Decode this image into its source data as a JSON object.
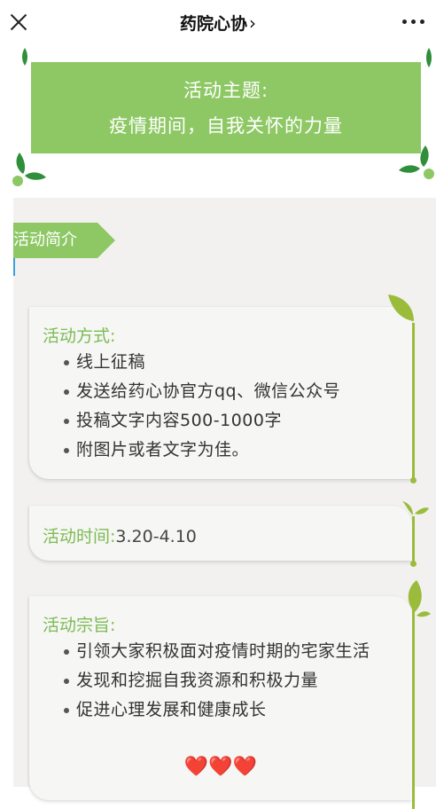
{
  "nav": {
    "title": "药院心协",
    "chevron": "›",
    "close_icon": "close-icon",
    "more_icon": "more-icon"
  },
  "banner": {
    "line1": "活动主题:",
    "line2": "疫情期间，自我关怀的力量",
    "color": "#8ec865"
  },
  "section_tag": {
    "label": "活动简介"
  },
  "card_method": {
    "heading": "活动方式:",
    "items": [
      "线上征稿",
      "发送给药心协官方qq、微信公众号",
      "投稿文字内容500-1000字",
      "附图片或者文字为佳。"
    ]
  },
  "card_time": {
    "heading": "活动时间:",
    "value": "3.20-4.10"
  },
  "card_purpose": {
    "heading": "活动宗旨:",
    "items": [
      "引领大家积极面对疫情时期的宅家生活",
      "发现和挖掘自我资源和积极力量",
      "促进心理发展和健康成长"
    ],
    "hearts": "❤️❤️❤️"
  },
  "colors": {
    "accent_green": "#8ec865",
    "heading_green": "#7cbb54",
    "vine_green": "#9abc3a",
    "section_bg": "#f2f1ef"
  }
}
